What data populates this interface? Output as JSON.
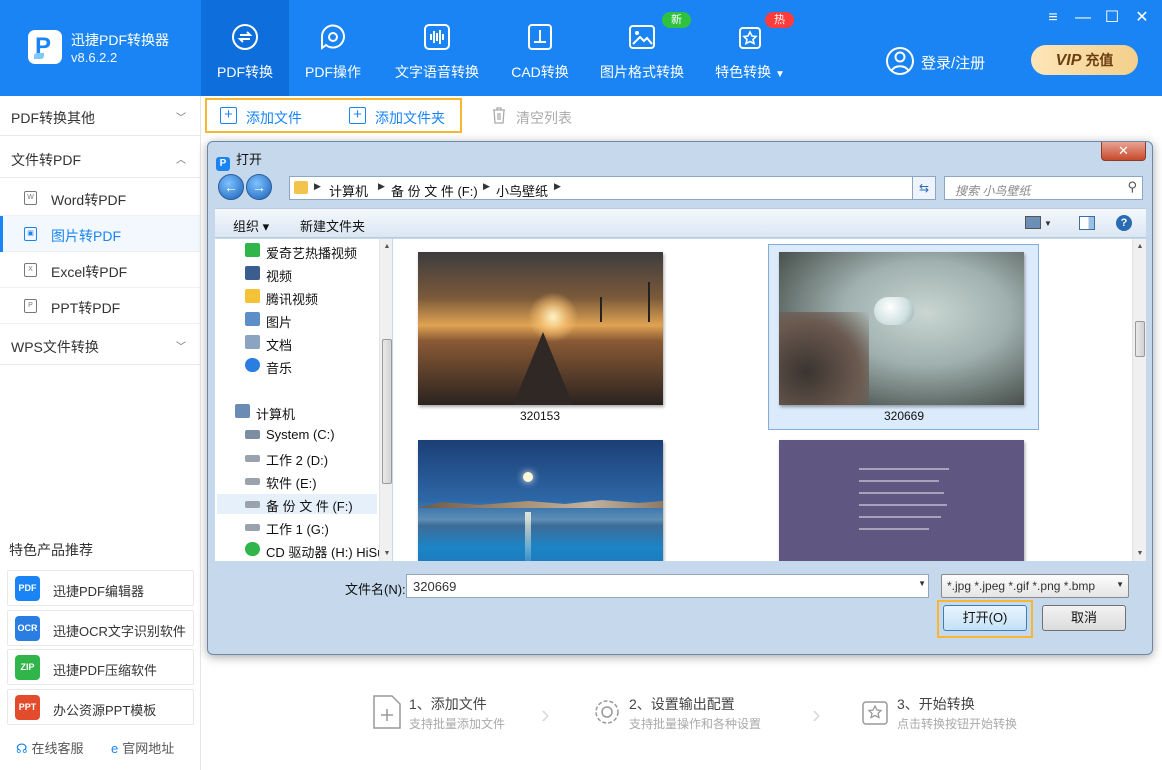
{
  "app": {
    "name": "迅捷PDF转换器",
    "version": "v8.6.2.2",
    "login": "登录/注册",
    "vip": {
      "tag": "VIP",
      "label": "充值"
    },
    "window_controls": [
      "≡",
      "—",
      "☐",
      "✕"
    ]
  },
  "nav": {
    "tabs": [
      {
        "label": "PDF转换",
        "active": true
      },
      {
        "label": "PDF操作",
        "active": false
      },
      {
        "label": "文字语音转换",
        "active": false
      },
      {
        "label": "CAD转换",
        "active": false
      },
      {
        "label": "图片格式转换",
        "active": false,
        "badge": "新"
      },
      {
        "label": "特色转换",
        "active": false,
        "badge": "热"
      }
    ]
  },
  "sidebar": {
    "groups": [
      {
        "label": "PDF转换其他",
        "expanded": false
      },
      {
        "label": "文件转PDF",
        "expanded": true
      },
      {
        "label": "WPS文件转换",
        "expanded": false
      }
    ],
    "items": [
      {
        "label": "Word转PDF",
        "icon": "W",
        "active": false
      },
      {
        "label": "图片转PDF",
        "icon": "▣",
        "active": true
      },
      {
        "label": "Excel转PDF",
        "icon": "X",
        "active": false
      },
      {
        "label": "PPT转PDF",
        "icon": "P",
        "active": false
      }
    ],
    "promo_title": "特色产品推荐",
    "promos": [
      {
        "label": "迅捷PDF编辑器",
        "icon_color": "#1a84f5",
        "icon_text": "PDF"
      },
      {
        "label": "迅捷OCR文字识别软件",
        "icon_color": "#2a7de1",
        "icon_text": "OCR"
      },
      {
        "label": "迅捷PDF压缩软件",
        "icon_color": "#2fb54a",
        "icon_text": "ZIP"
      },
      {
        "label": "办公资源PPT模板",
        "icon_color": "#e24b2b",
        "icon_text": "PPT"
      }
    ],
    "support": "在线客服",
    "website": "官网地址"
  },
  "toolbar": {
    "add_file": "添加文件",
    "add_folder": "添加文件夹",
    "clear": "清空列表"
  },
  "steps": [
    {
      "title": "1、添加文件",
      "desc": "支持批量添加文件"
    },
    {
      "title": "2、设置输出配置",
      "desc": "支持批量操作和各种设置"
    },
    {
      "title": "3、开始转换",
      "desc": "点击转换按钮开始转换"
    }
  ],
  "dialog": {
    "title": "打开",
    "breadcrumb": [
      "计算机",
      "备 份 文 件 (F:)",
      "小鸟壁纸"
    ],
    "search_placeholder": "搜索 小鸟壁纸",
    "organize": "组织 ▾",
    "new_folder": "新建文件夹",
    "tree": [
      {
        "label": "爱奇艺热播视频",
        "color": "#2fb54a"
      },
      {
        "label": "视频",
        "color": "#3a5f8f"
      },
      {
        "label": "腾讯视频",
        "color": "#f3c237"
      },
      {
        "label": "图片",
        "color": "#5c8fc7"
      },
      {
        "label": "文档",
        "color": "#8aa4c2"
      },
      {
        "label": "音乐",
        "color": "#2a7de1"
      },
      {
        "label": "计算机",
        "color": "#6a8bb3"
      },
      {
        "label": "System (C:)",
        "color": "#7d8ea3"
      },
      {
        "label": "工作 2 (D:)",
        "color": "#9aa3ad"
      },
      {
        "label": "软件 (E:)",
        "color": "#9aa3ad"
      },
      {
        "label": "备 份 文 件 (F:)",
        "color": "#9aa3ad",
        "selected": true
      },
      {
        "label": "工作 1 (G:)",
        "color": "#9aa3ad"
      },
      {
        "label": "CD 驱动器 (H:) HiSu",
        "color": "#2fb54a"
      }
    ],
    "files": [
      {
        "name": "320153",
        "selected": false
      },
      {
        "name": "320669",
        "selected": true
      },
      {
        "name": "",
        "selected": false
      },
      {
        "name": "",
        "selected": false
      }
    ],
    "filename_label": "文件名(N):",
    "filename_value": "320669",
    "filetype": "*.jpg *.jpeg *.gif *.png *.bmp",
    "open_button": "打开(O)",
    "cancel_button": "取消"
  }
}
